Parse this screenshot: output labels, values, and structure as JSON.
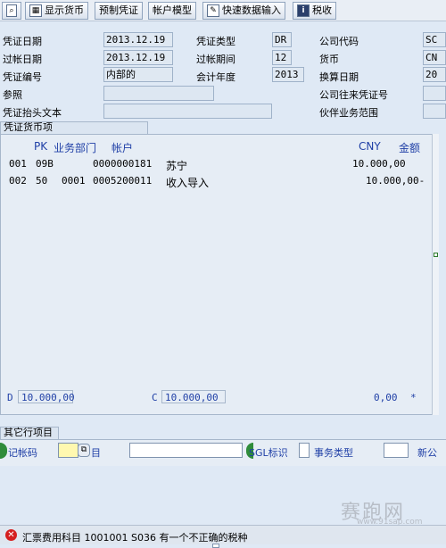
{
  "toolbar": {
    "show_currency": "显示货币",
    "park": "预制凭证",
    "account_model": "帐户模型",
    "fast_entry": "快速数据输入",
    "tax": "税收"
  },
  "header": {
    "doc_date_label": "凭证日期",
    "doc_date": "2013.12.19",
    "doc_type_label": "凭证类型",
    "doc_type": "DR",
    "company_code_label": "公司代码",
    "company_code": "SC",
    "posting_date_label": "过帐日期",
    "posting_date": "2013.12.19",
    "period_label": "过帐期间",
    "period": "12",
    "currency_label": "货币",
    "currency": "CN",
    "doc_no_label": "凭证编号",
    "doc_no": "内部的",
    "fiscal_year_label": "会计年度",
    "fiscal_year": "2013",
    "translation_date_label": "换算日期",
    "translation_date": "20",
    "reference_label": "参照",
    "intercompany_label": "公司往来凭证号",
    "header_text_label": "凭证抬头文本",
    "trading_partner_label": "伙伴业务范围"
  },
  "items": {
    "section_title": "凭证货币项",
    "col_pk": "PK",
    "col_bus_area": "业务部门",
    "col_account": "帐户",
    "col_currency": "CNY",
    "col_amount": "金额",
    "rows": [
      {
        "no": "001",
        "pk": "09B",
        "bus_area": "",
        "account": "0000000181",
        "text": "苏宁",
        "amount": "10.000,00"
      },
      {
        "no": "002",
        "pk": "50",
        "bus_area": "0001",
        "account": "0005200011",
        "text": "收入导入",
        "amount": "10.000,00-"
      }
    ],
    "debit_label": "D",
    "debit_total": "10.000,00",
    "credit_label": "C",
    "credit_total": "10.000,00",
    "balance": "0,00",
    "balance_flag": "*"
  },
  "other": {
    "section_title": "其它行项目",
    "posting_key_label": "记帐码",
    "account_label": "目",
    "sgl_label": "SGL标识",
    "trans_type_label": "事务类型",
    "new_cc_label": "新公"
  },
  "status": {
    "message": "汇票费用科目 1001001 S036 有一个不正确的税种"
  },
  "watermark": {
    "text": "赛跑网",
    "url": "www.91sap.com"
  }
}
